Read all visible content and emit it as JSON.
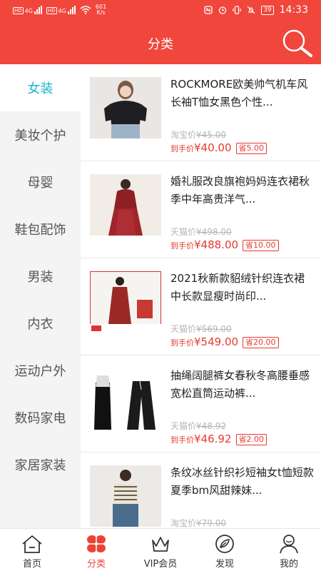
{
  "status_bar": {
    "net_speed_value": "601",
    "net_speed_unit": "K/s",
    "network_1": "4G",
    "network_2": "4G",
    "battery": "39",
    "time": "14:33"
  },
  "header": {
    "title": "分类",
    "search_icon": "search-icon"
  },
  "sidebar": {
    "selected": "女装",
    "items": [
      {
        "label": "女装"
      },
      {
        "label": "美妆个护"
      },
      {
        "label": "母婴"
      },
      {
        "label": "鞋包配饰"
      },
      {
        "label": "男装"
      },
      {
        "label": "内衣"
      },
      {
        "label": "运动户外"
      },
      {
        "label": "数码家电"
      },
      {
        "label": "家居家装"
      }
    ]
  },
  "products": [
    {
      "title": "ROCKMORE欧美帅气机车风长袖T恤女黑色个性...",
      "orig_label": "淘宝价",
      "orig_price": "¥45.00",
      "final_label": "到手价",
      "final_price": "¥40.00",
      "coupon_label": "省",
      "coupon_value": "5.00"
    },
    {
      "title": "婚礼服改良旗袍妈妈连衣裙秋季中年高贵洋气...",
      "orig_label": "天猫价",
      "orig_price": "¥498.00",
      "final_label": "到手价",
      "final_price": "¥488.00",
      "coupon_label": "省",
      "coupon_value": "10.00"
    },
    {
      "title": "2021秋新款貂绒针织连衣裙中长款显瘦时尚印...",
      "orig_label": "天猫价",
      "orig_price": "¥569.00",
      "final_label": "到手价",
      "final_price": "¥549.00",
      "coupon_label": "省",
      "coupon_value": "20.00"
    },
    {
      "title": "抽绳阔腿裤女春秋冬高腰垂感宽松直筒运动裤...",
      "orig_label": "天猫价",
      "orig_price": "¥48.92",
      "final_label": "到手价",
      "final_price": "¥46.92",
      "coupon_label": "省",
      "coupon_value": "2.00"
    },
    {
      "title": "条纹冰丝针织衫短袖女t恤短款夏季bm风甜辣妹...",
      "orig_label": "淘宝价",
      "orig_price": "¥79.00",
      "final_label": "",
      "final_price": "",
      "coupon_label": "",
      "coupon_value": ""
    }
  ],
  "bottom_nav": {
    "selected": "分类",
    "tabs": [
      {
        "label": "首页",
        "icon": "home-icon"
      },
      {
        "label": "分类",
        "icon": "category-icon"
      },
      {
        "label": "VIP会员",
        "icon": "crown-icon"
      },
      {
        "label": "发现",
        "icon": "discover-icon"
      },
      {
        "label": "我的",
        "icon": "profile-icon"
      }
    ]
  },
  "colors": {
    "primary": "#f0463c",
    "accent": "#19b4cc",
    "price": "#e83a2f"
  }
}
